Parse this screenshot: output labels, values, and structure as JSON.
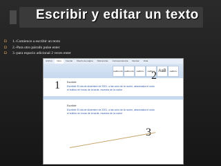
{
  "slide": {
    "title": "Escribir y editar un texto",
    "bullets": [
      "1.-Comience a escribir un texto",
      "2.-Para otro párrafo pulse enter",
      "3.-para espacio adicional 2 veces enter"
    ]
  },
  "screenshots": {
    "tabs": [
      "Archivo",
      "Inicio",
      "Insertar",
      "Diseño de página",
      "Referencias",
      "Correspondencia",
      "Revisar",
      "Vista"
    ],
    "styles": [
      "AaBbCcDc",
      "AaBbCcDc",
      "AaBbCc",
      "AaBbCc",
      "AaB",
      "AaBbCc"
    ],
    "step_numbers": [
      "1",
      "2",
      "3"
    ],
    "doc_heading": "Escribiré",
    "doc_line_1": "Escribiré  El día de diciembre de 2001, a las ocho de la noche, atravesaba  el ruido",
    "doc_line_2": "el bullicio en horas de la tarde, muestra de la noche"
  },
  "colors": {
    "bullet": "#cfa05b",
    "arrow": "#c9a36a"
  }
}
